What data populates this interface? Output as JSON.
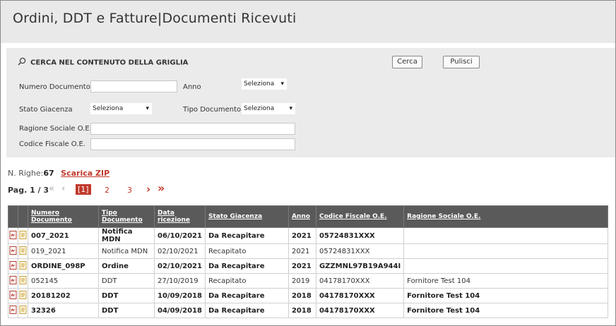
{
  "page": {
    "title": "Ordini, DDT e Fatture|Documenti Ricevuti"
  },
  "search": {
    "heading": "CERCA NEL CONTENUTO DELLA GRIGLIA",
    "cerca_label": "Cerca",
    "pulisci_label": "Pulisci",
    "fields": {
      "numero_documento": "Numero Documento",
      "anno": "Anno",
      "anno_value": "Seleziona",
      "stato_giacenza": "Stato Giacenza",
      "stato_value": "Seleziona",
      "tipo_documento": "Tipo Documento",
      "tipo_value": "Seleziona",
      "ragione_sociale": "Ragione Sociale O.E.",
      "codice_fiscale": "Codice Fiscale O.E."
    }
  },
  "summary": {
    "n_righe_label": "N. Righe:",
    "n_righe_value": "67",
    "scarica_zip": "Scarica ZIP"
  },
  "pager": {
    "label": "Pag. 1 / 3",
    "first": "«",
    "prev": "‹",
    "current": "[1]",
    "p2": "2",
    "p3": "3",
    "next": "›",
    "last": "»"
  },
  "table": {
    "headers": {
      "numero": "Numero Documento",
      "tipo": "Tipo Documento",
      "data": "Data ricezione",
      "stato": "Stato Giacenza",
      "anno": "Anno",
      "codice": "Codice Fiscale O.E.",
      "ragione": "Ragione Sociale O.E."
    },
    "rows": [
      {
        "numero": "007_2021",
        "tipo": "Notifica MDN",
        "data": "06/10/2021",
        "stato": "Da Recapitare",
        "anno": "2021",
        "codice": "05724831XXX",
        "ragione": ""
      },
      {
        "numero": "019_2021",
        "tipo": "Notifica MDN",
        "data": "02/10/2021",
        "stato": "Recapitato",
        "anno": "2021",
        "codice": "05724831XXX",
        "ragione": ""
      },
      {
        "numero": "ORDINE_098P",
        "tipo": "Ordine",
        "data": "02/10/2021",
        "stato": "Da Recapitare",
        "anno": "2021",
        "codice": "GZZMNL97B19A944I",
        "ragione": ""
      },
      {
        "numero": "052145",
        "tipo": "DDT",
        "data": "27/10/2019",
        "stato": "Recapitato",
        "anno": "2019",
        "codice": "04178170XXX",
        "ragione": "Fornitore Test 104"
      },
      {
        "numero": "20181202",
        "tipo": "DDT",
        "data": "10/09/2018",
        "stato": "Da Recapitare",
        "anno": "2018",
        "codice": "04178170XXX",
        "ragione": "Fornitore Test 104"
      },
      {
        "numero": "32326",
        "tipo": "DDT",
        "data": "04/09/2018",
        "stato": "Da Recapitare",
        "anno": "2018",
        "codice": "04178170XXX",
        "ragione": "Fornitore Test 104"
      }
    ]
  },
  "colors": {
    "accent_red": "#c0392b",
    "header_dark": "#5a5a5a",
    "panel_gray": "#ebebeb"
  }
}
